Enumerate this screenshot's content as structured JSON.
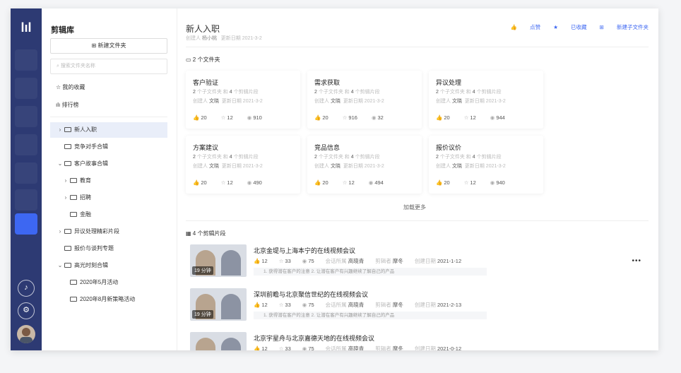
{
  "rail": {
    "logo": "lıl"
  },
  "sidebar": {
    "title": "剪辑库",
    "new_folder": "新建文件夹",
    "search_placeholder": "搜索文件夹名称",
    "favorites": "我的收藏",
    "ranking": "排行榜",
    "tree": [
      {
        "label": "新人入职",
        "chevron": "›"
      },
      {
        "label": "竞争对手合辑",
        "chevron": ""
      },
      {
        "label": "客户故事合辑",
        "chevron": "⌄"
      },
      {
        "label": "教育",
        "chevron": "›"
      },
      {
        "label": "招聘",
        "chevron": "›"
      },
      {
        "label": "金融",
        "chevron": ""
      },
      {
        "label": "异议处理精彩片段",
        "chevron": "›"
      },
      {
        "label": "报价与谈判专题",
        "chevron": ""
      },
      {
        "label": "高光时刻合辑",
        "chevron": "⌄"
      },
      {
        "label": "2020年5月活动",
        "chevron": ""
      },
      {
        "label": "2020年8月新策略活动",
        "chevron": ""
      }
    ]
  },
  "header": {
    "title": "新人入职",
    "creator_label": "创建人",
    "creator": "杨小桃",
    "updated_label": "更新日期",
    "updated": "2021-3-2",
    "like": "点赞",
    "favorited": "已收藏",
    "new_subfolder": "新建子文件夹"
  },
  "folders_section": "2 个文件夹",
  "folders": [
    {
      "title": "客户验证",
      "sub": [
        "2",
        "个子文件夹 和",
        "4",
        "个剪辑片段"
      ],
      "creator_label": "创建人",
      "creator": "文晓",
      "updated_label": "更新日期",
      "updated": "2021-3-2",
      "likes": "20",
      "stars": "12",
      "views": "910"
    },
    {
      "title": "需求获取",
      "sub": [
        "2",
        "个子文件夹 和",
        "4",
        "个剪辑片段"
      ],
      "creator_label": "创建人",
      "creator": "文晓",
      "updated_label": "更新日期",
      "updated": "2021-3-2",
      "likes": "20",
      "stars": "916",
      "views": "32"
    },
    {
      "title": "异议处理",
      "sub": [
        "2",
        "个子文件夹 和",
        "4",
        "个剪辑片段"
      ],
      "creator_label": "创建人",
      "creator": "文晓",
      "updated_label": "更新日期",
      "updated": "2021-3-2",
      "likes": "20",
      "stars": "12",
      "views": "944"
    },
    {
      "title": "方案建议",
      "sub": [
        "2",
        "个子文件夹 和",
        "4",
        "个剪辑片段"
      ],
      "creator_label": "创建人",
      "creator": "文晓",
      "updated_label": "更新日期",
      "updated": "2021-3-2",
      "likes": "20",
      "stars": "12",
      "views": "490"
    },
    {
      "title": "竞品信息",
      "sub": [
        "2",
        "个子文件夹 和",
        "4",
        "个剪辑片段"
      ],
      "creator_label": "创建人",
      "creator": "文晓",
      "updated_label": "更新日期",
      "updated": "2021-3-2",
      "likes": "20",
      "stars": "12",
      "views": "494"
    },
    {
      "title": "报价议价",
      "sub": [
        "2",
        "个子文件夹 和",
        "4",
        "个剪辑片段"
      ],
      "creator_label": "创建人",
      "creator": "文晓",
      "updated_label": "更新日期",
      "updated": "2021-3-2",
      "likes": "20",
      "stars": "12",
      "views": "940"
    }
  ],
  "load_more": "加载更多",
  "clips_section": "4 个剪辑片段",
  "clips": [
    {
      "title": "北京金堤与上海本宁的在线视频会议",
      "duration": "19 分钟",
      "likes": "12",
      "stars": "33",
      "views": "75",
      "owner_label": "会话所属",
      "owner": "高晓青",
      "editor_label": "剪辑者",
      "editor": "摩冬",
      "date_label": "创建日期",
      "date": "2021-1-12",
      "desc": "1. 获得潜在客户的注意 2. 让潜在客户有兴趣继续了解自己的产品"
    },
    {
      "title": "深圳前瞻与北京聚信世纪的在线视频会议",
      "duration": "19 分钟",
      "likes": "12",
      "stars": "33",
      "views": "75",
      "owner_label": "会话所属",
      "owner": "高晓青",
      "editor_label": "剪辑者",
      "editor": "摩冬",
      "date_label": "创建日期",
      "date": "2021-2-13",
      "desc": "1. 获得潜在客户的注意 2. 让潜在客户有兴趣继续了解自己的产品"
    },
    {
      "title": "北京宇星舟与北京嘉德天地的在线视频会议",
      "duration": "",
      "likes": "12",
      "stars": "33",
      "views": "75",
      "owner_label": "会话所属",
      "owner": "高晓青",
      "editor_label": "剪辑者",
      "editor": "摩冬",
      "date_label": "创建日期",
      "date": "2021-0-12",
      "desc": ""
    }
  ]
}
